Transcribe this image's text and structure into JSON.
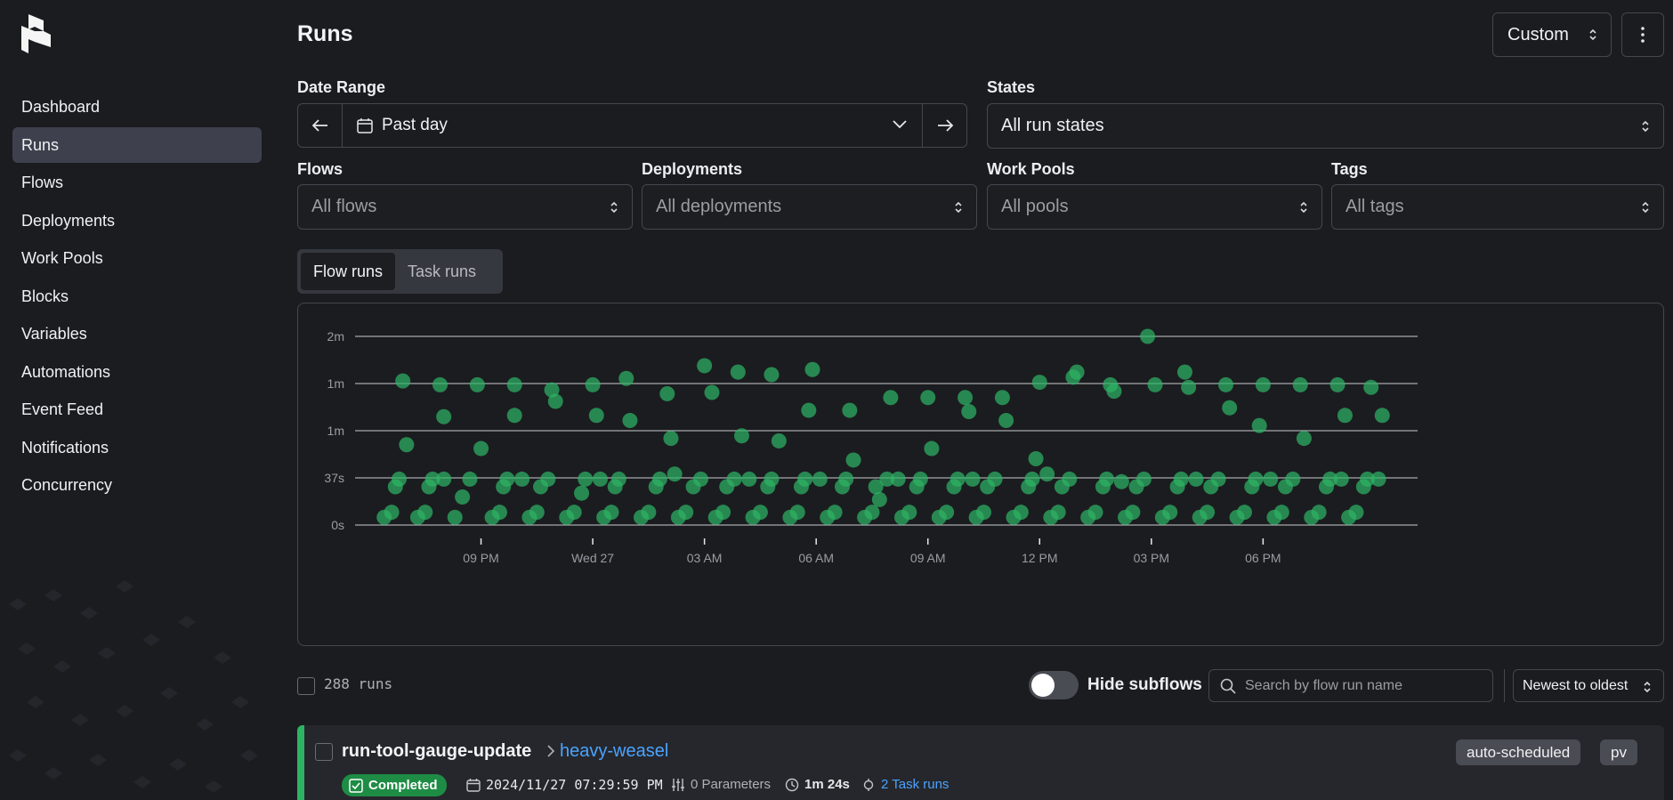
{
  "sidebar": {
    "items": [
      {
        "label": "Dashboard",
        "active": false
      },
      {
        "label": "Runs",
        "active": true
      },
      {
        "label": "Flows",
        "active": false
      },
      {
        "label": "Deployments",
        "active": false
      },
      {
        "label": "Work Pools",
        "active": false
      },
      {
        "label": "Blocks",
        "active": false
      },
      {
        "label": "Variables",
        "active": false
      },
      {
        "label": "Automations",
        "active": false
      },
      {
        "label": "Event Feed",
        "active": false
      },
      {
        "label": "Notifications",
        "active": false
      },
      {
        "label": "Concurrency",
        "active": false
      }
    ]
  },
  "header": {
    "title": "Runs",
    "view_select": "Custom"
  },
  "filters": {
    "date_range": {
      "label": "Date Range",
      "value": "Past day"
    },
    "states": {
      "label": "States",
      "value": "All run states"
    },
    "flows": {
      "label": "Flows",
      "placeholder": "All flows"
    },
    "deployments": {
      "label": "Deployments",
      "placeholder": "All deployments"
    },
    "work_pools": {
      "label": "Work Pools",
      "placeholder": "All pools"
    },
    "tags": {
      "label": "Tags",
      "placeholder": "All tags"
    }
  },
  "tabs": [
    {
      "label": "Flow runs",
      "active": true
    },
    {
      "label": "Task runs",
      "active": false
    }
  ],
  "chart_data": {
    "type": "scatter",
    "title": "",
    "xlabel": "",
    "ylabel": "",
    "y_tick_labels": [
      "0s",
      "37s",
      "1m",
      "1m",
      "2m"
    ],
    "y_tick_values": [
      0,
      37,
      74,
      111,
      148
    ],
    "x_tick_labels": [
      "09 PM",
      "Wed 27",
      "03 AM",
      "06 AM",
      "09 AM",
      "12 PM",
      "03 PM",
      "06 PM"
    ],
    "x_tick_hours": [
      3,
      6,
      9,
      12,
      15,
      18,
      21,
      24
    ],
    "x_range_hours": [
      0,
      27.6
    ],
    "y_range_seconds": [
      0,
      148
    ],
    "point_color": "#2eb364",
    "points": [
      [
        0.4,
        6
      ],
      [
        0.6,
        10
      ],
      [
        0.7,
        30
      ],
      [
        0.8,
        36
      ],
      [
        0.9,
        113
      ],
      [
        1.0,
        63
      ],
      [
        1.3,
        6
      ],
      [
        1.5,
        10
      ],
      [
        1.6,
        30
      ],
      [
        1.7,
        36
      ],
      [
        1.9,
        110
      ],
      [
        2.0,
        85
      ],
      [
        2.3,
        6
      ],
      [
        2.5,
        22
      ],
      [
        2.7,
        36
      ],
      [
        2.9,
        110
      ],
      [
        3.0,
        60
      ],
      [
        3.3,
        6
      ],
      [
        3.5,
        10
      ],
      [
        3.6,
        30
      ],
      [
        3.7,
        36
      ],
      [
        3.9,
        110
      ],
      [
        3.9,
        86
      ],
      [
        4.3,
        6
      ],
      [
        4.5,
        10
      ],
      [
        4.6,
        30
      ],
      [
        4.8,
        36
      ],
      [
        4.9,
        106
      ],
      [
        5.0,
        97
      ],
      [
        5.3,
        6
      ],
      [
        5.5,
        10
      ],
      [
        5.7,
        25
      ],
      [
        5.8,
        36
      ],
      [
        6.0,
        110
      ],
      [
        6.1,
        86
      ],
      [
        6.3,
        6
      ],
      [
        6.5,
        10
      ],
      [
        6.6,
        30
      ],
      [
        6.7,
        36
      ],
      [
        6.9,
        115
      ],
      [
        7.0,
        82
      ],
      [
        7.3,
        6
      ],
      [
        7.5,
        10
      ],
      [
        7.7,
        30
      ],
      [
        7.8,
        36
      ],
      [
        8.0,
        103
      ],
      [
        8.1,
        68
      ],
      [
        8.3,
        6
      ],
      [
        8.5,
        10
      ],
      [
        8.7,
        30
      ],
      [
        8.9,
        36
      ],
      [
        9.0,
        125
      ],
      [
        9.2,
        104
      ],
      [
        9.3,
        6
      ],
      [
        9.5,
        10
      ],
      [
        9.6,
        30
      ],
      [
        9.8,
        36
      ],
      [
        9.9,
        120
      ],
      [
        10.0,
        70
      ],
      [
        10.3,
        6
      ],
      [
        10.5,
        10
      ],
      [
        10.7,
        30
      ],
      [
        10.8,
        36
      ],
      [
        10.8,
        118
      ],
      [
        11.0,
        66
      ],
      [
        11.3,
        6
      ],
      [
        11.5,
        10
      ],
      [
        11.6,
        30
      ],
      [
        11.7,
        36
      ],
      [
        11.8,
        90
      ],
      [
        11.9,
        122
      ],
      [
        12.3,
        6
      ],
      [
        12.5,
        10
      ],
      [
        12.7,
        30
      ],
      [
        12.8,
        36
      ],
      [
        12.9,
        90
      ],
      [
        13.0,
        51
      ],
      [
        13.3,
        6
      ],
      [
        13.5,
        10
      ],
      [
        13.6,
        30
      ],
      [
        13.7,
        20
      ],
      [
        13.9,
        36
      ],
      [
        14.0,
        100
      ],
      [
        14.3,
        6
      ],
      [
        14.5,
        10
      ],
      [
        14.7,
        30
      ],
      [
        14.8,
        36
      ],
      [
        15.0,
        100
      ],
      [
        15.1,
        60
      ],
      [
        15.3,
        6
      ],
      [
        15.5,
        10
      ],
      [
        15.7,
        30
      ],
      [
        15.8,
        36
      ],
      [
        16.0,
        100
      ],
      [
        16.1,
        89
      ],
      [
        16.3,
        6
      ],
      [
        16.5,
        10
      ],
      [
        16.6,
        30
      ],
      [
        16.8,
        36
      ],
      [
        17.0,
        100
      ],
      [
        17.1,
        82
      ],
      [
        17.3,
        6
      ],
      [
        17.5,
        10
      ],
      [
        17.7,
        30
      ],
      [
        17.8,
        36
      ],
      [
        17.9,
        52
      ],
      [
        18.0,
        112
      ],
      [
        18.3,
        6
      ],
      [
        18.5,
        10
      ],
      [
        18.6,
        30
      ],
      [
        18.8,
        36
      ],
      [
        18.9,
        116
      ],
      [
        19.0,
        120
      ],
      [
        19.3,
        6
      ],
      [
        19.5,
        10
      ],
      [
        19.7,
        30
      ],
      [
        19.8,
        36
      ],
      [
        19.9,
        110
      ],
      [
        20.0,
        105
      ],
      [
        20.3,
        6
      ],
      [
        20.5,
        10
      ],
      [
        20.6,
        30
      ],
      [
        20.8,
        36
      ],
      [
        20.9,
        148
      ],
      [
        21.1,
        110
      ],
      [
        21.3,
        6
      ],
      [
        21.5,
        10
      ],
      [
        21.7,
        30
      ],
      [
        21.8,
        36
      ],
      [
        21.9,
        120
      ],
      [
        22.0,
        108
      ],
      [
        22.3,
        6
      ],
      [
        22.5,
        10
      ],
      [
        22.6,
        30
      ],
      [
        22.8,
        36
      ],
      [
        23.0,
        110
      ],
      [
        23.1,
        92
      ],
      [
        23.3,
        6
      ],
      [
        23.5,
        10
      ],
      [
        23.7,
        30
      ],
      [
        23.8,
        36
      ],
      [
        23.9,
        78
      ],
      [
        24.0,
        110
      ],
      [
        24.3,
        6
      ],
      [
        24.5,
        10
      ],
      [
        24.6,
        30
      ],
      [
        24.8,
        36
      ],
      [
        25.0,
        110
      ],
      [
        25.1,
        68
      ],
      [
        25.3,
        6
      ],
      [
        25.5,
        10
      ],
      [
        25.7,
        30
      ],
      [
        25.8,
        36
      ],
      [
        26.0,
        110
      ],
      [
        26.2,
        86
      ],
      [
        26.3,
        6
      ],
      [
        26.5,
        10
      ],
      [
        26.7,
        30
      ],
      [
        26.8,
        36
      ],
      [
        26.9,
        108
      ],
      [
        27.2,
        86
      ],
      [
        2.0,
        36
      ],
      [
        4.1,
        36
      ],
      [
        6.2,
        36
      ],
      [
        8.2,
        40
      ],
      [
        10.2,
        36
      ],
      [
        12.1,
        36
      ],
      [
        14.2,
        36
      ],
      [
        16.2,
        36
      ],
      [
        18.2,
        40
      ],
      [
        20.2,
        34
      ],
      [
        22.2,
        36
      ],
      [
        24.2,
        36
      ],
      [
        26.1,
        36
      ],
      [
        27.1,
        36
      ]
    ]
  },
  "list": {
    "count": "288",
    "count_unit": "runs",
    "hide_subflows_label": "Hide subflows",
    "hide_subflows_on": false,
    "search_placeholder": "Search by flow run name",
    "sort": "Newest to oldest"
  },
  "run": {
    "flow_name": "run-tool-gauge-update",
    "run_name": "heavy-weasel",
    "state": "Completed",
    "state_color": "#1e8c45",
    "start_time": "2024/11/27 07:29:59 PM",
    "parameters": "0 Parameters",
    "duration": "1m 24s",
    "task_runs": "2 Task runs",
    "tags": [
      "auto-scheduled",
      "pv"
    ]
  }
}
